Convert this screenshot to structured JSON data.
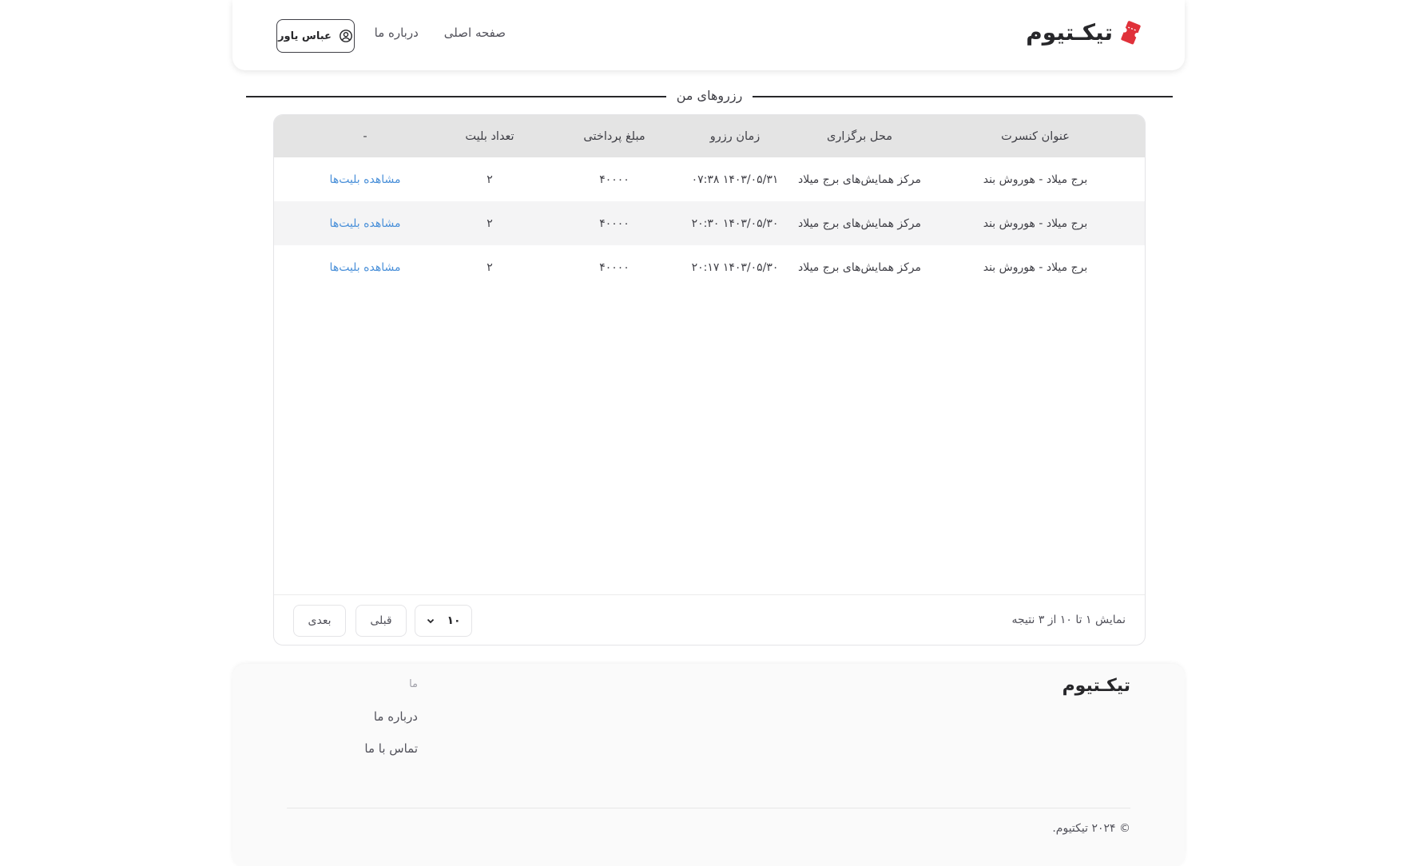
{
  "header": {
    "brand": "تیکـتیوم",
    "nav": [
      "صفحه اصلی",
      "درباره ما"
    ],
    "user_name": "عباس یاور"
  },
  "section_title": "رزروهای من",
  "table": {
    "columns": [
      "عنوان کنسرت",
      "محل برگزاری",
      "زمان رزرو",
      "مبلغ پرداختی",
      "تعداد بلیت",
      "-"
    ],
    "rows": [
      {
        "title": "برج میلاد - هوروش بند",
        "place": "مرکز همایش‌های برج میلاد",
        "time": "۱۴۰۳/۰۵/۳۱ ۰۷:۳۸",
        "amount": "۴۰۰۰۰",
        "count": "۲",
        "action": "مشاهده بلیت‌ها"
      },
      {
        "title": "برج میلاد - هوروش بند",
        "place": "مرکز همایش‌های برج میلاد",
        "time": "۱۴۰۳/۰۵/۳۰ ۲۰:۳۰",
        "amount": "۴۰۰۰۰",
        "count": "۲",
        "action": "مشاهده بلیت‌ها"
      },
      {
        "title": "برج میلاد - هوروش بند",
        "place": "مرکز همایش‌های برج میلاد",
        "time": "۱۴۰۳/۰۵/۳۰ ۲۰:۱۷",
        "amount": "۴۰۰۰۰",
        "count": "۲",
        "action": "مشاهده بلیت‌ها"
      }
    ]
  },
  "pagination": {
    "result_text": "نمایش ۱ تا ۱۰ از ۳ نتیجه",
    "page_size": "۱۰",
    "prev_label": "قبلی",
    "next_label": "بعدی"
  },
  "footer": {
    "brand": "تیکـتیوم",
    "column_title": "ما",
    "links": [
      "درباره ما",
      "تماس با ما"
    ],
    "copyright": "© ۲۰۲۴ تیکتیوم."
  },
  "colors": {
    "accent_red": "#e0313a",
    "link_blue": "#4a90d9"
  }
}
